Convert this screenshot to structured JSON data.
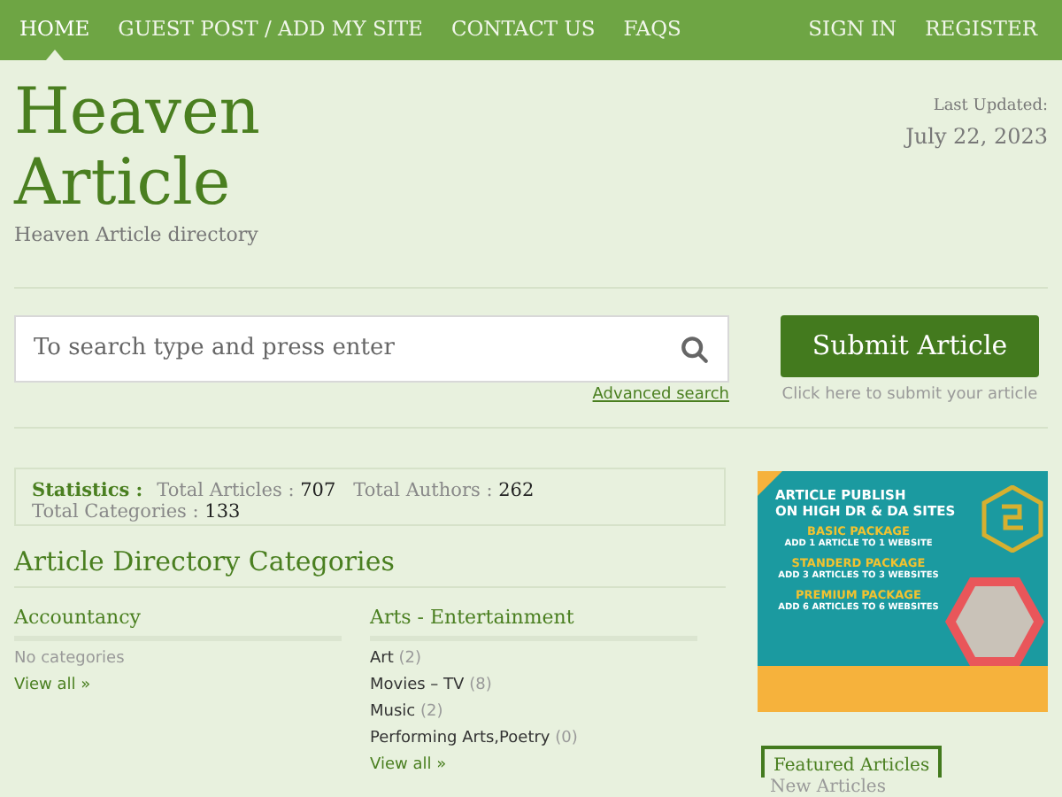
{
  "nav": {
    "left": [
      {
        "label": "HOME",
        "selected": true
      },
      {
        "label": "GUEST POST / ADD MY SITE",
        "selected": false
      },
      {
        "label": "CONTACT US",
        "selected": false
      },
      {
        "label": "FAQS",
        "selected": false
      }
    ],
    "right": [
      {
        "label": "SIGN IN",
        "selected": false
      },
      {
        "label": "REGISTER",
        "selected": false
      }
    ]
  },
  "site": {
    "title_lines": [
      "Heaven",
      "Article"
    ],
    "tagline": "Heaven Article directory",
    "updated_label": "Last Updated:",
    "updated_date": "July 22, 2023"
  },
  "search": {
    "placeholder": "To search type and press enter",
    "advanced_link": "Advanced search"
  },
  "submit": {
    "label": "Submit Article",
    "hint": "Click here to submit your article"
  },
  "statistics": {
    "label": "Statistics :",
    "items": [
      {
        "name": "Total Articles :",
        "value": "707"
      },
      {
        "name": "Total Authors :",
        "value": "262"
      },
      {
        "name": "Total Categories :",
        "value": "133"
      }
    ]
  },
  "categories": {
    "heading": "Article Directory Categories",
    "groups": [
      {
        "title": "Accountancy",
        "empty_text": "No categories",
        "view_all": "View all »"
      },
      {
        "title": "Arts - Entertainment",
        "items": [
          {
            "name": "Art",
            "count": "(2)"
          },
          {
            "name": "Movies – TV",
            "count": "(8)"
          },
          {
            "name": "Music",
            "count": "(2)"
          },
          {
            "name": "Performing Arts,Poetry",
            "count": "(0)"
          }
        ],
        "view_all": "View all »"
      }
    ]
  },
  "ad_banner": {
    "headline": [
      "ARTICLE PUBLISH",
      "ON HIGH DR & DA SITES"
    ],
    "packages": [
      {
        "name": "BASIC PACKAGE",
        "detail": "ADD 1 ARTICLE TO 1 WEBSITE"
      },
      {
        "name": "STANDERD PACKAGE",
        "detail": "ADD 3 ARTICLES TO 3 WEBSITES"
      },
      {
        "name": "PREMIUM PACKAGE",
        "detail": "ADD 6 ARTICLES TO 6 WEBSITES"
      }
    ]
  },
  "sidebar_tabs": [
    {
      "label": "Featured Articles",
      "selected": true
    },
    {
      "label": "New Articles",
      "selected": false
    }
  ]
}
